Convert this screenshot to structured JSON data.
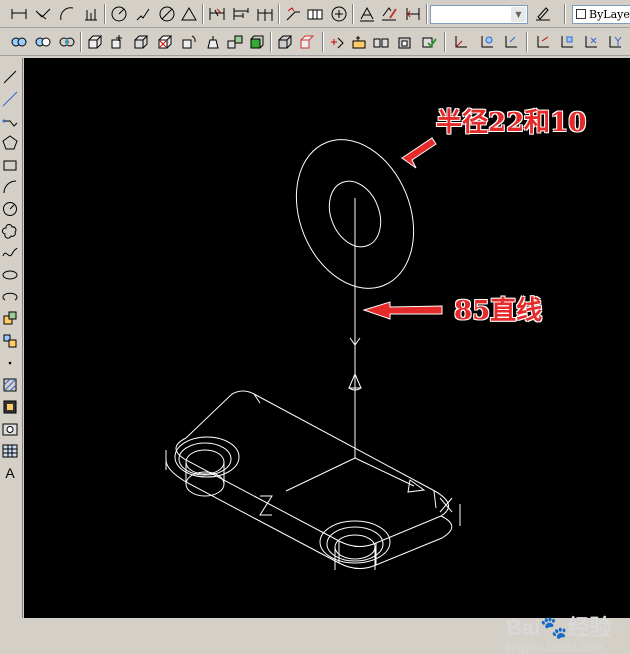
{
  "toolbar": {
    "layer_combo_value": "",
    "lineweight_label": "ByLayer"
  },
  "left_toolbar": {
    "text_tool_label": "A"
  },
  "canvas": {
    "annotation_radius": "半径22和10",
    "annotation_line": "85直线",
    "axis_y_label": "Y",
    "axis_z_label": "Z",
    "axis_x_label": "X",
    "line_color": "#ffffff",
    "annotation_color": "#e52a2a"
  },
  "watermark": {
    "logo_text": "Bai",
    "logo_suffix": "经验",
    "sub_text": "jingyan.baidu.com"
  }
}
